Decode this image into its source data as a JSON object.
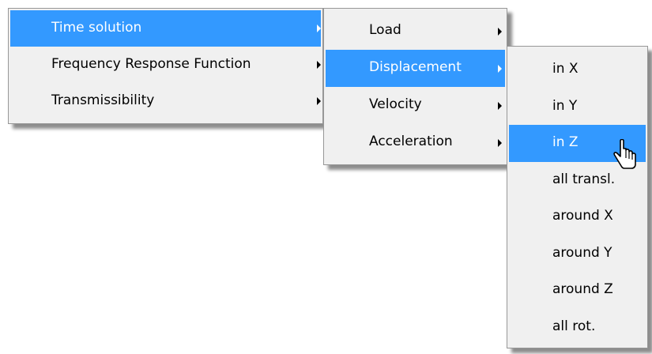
{
  "menu1": {
    "items": [
      {
        "label": "Time solution",
        "has_submenu": true,
        "highlighted": true
      },
      {
        "label": "Frequency Response Function",
        "has_submenu": true,
        "highlighted": false
      },
      {
        "label": "Transmissibility",
        "has_submenu": true,
        "highlighted": false
      }
    ]
  },
  "menu2": {
    "items": [
      {
        "label": "Load",
        "has_submenu": true,
        "highlighted": false
      },
      {
        "label": "Displacement",
        "has_submenu": true,
        "highlighted": true
      },
      {
        "label": "Velocity",
        "has_submenu": true,
        "highlighted": false
      },
      {
        "label": "Acceleration",
        "has_submenu": true,
        "highlighted": false
      }
    ]
  },
  "menu3": {
    "items": [
      {
        "label": "in X",
        "highlighted": false
      },
      {
        "label": "in Y",
        "highlighted": false
      },
      {
        "label": "in Z",
        "highlighted": true
      },
      {
        "label": "all transl.",
        "highlighted": false
      },
      {
        "label": "around X",
        "highlighted": false
      },
      {
        "label": "around Y",
        "highlighted": false
      },
      {
        "label": "around Z",
        "highlighted": false
      },
      {
        "label": "all rot.",
        "highlighted": false
      }
    ]
  },
  "colors": {
    "highlight": "#3399ff",
    "menu_background": "#f0f0f0",
    "menu_border": "#979797"
  },
  "icons": {
    "submenu_arrow": "chevron-right-icon",
    "cursor": "mouse-pointer-icon"
  }
}
